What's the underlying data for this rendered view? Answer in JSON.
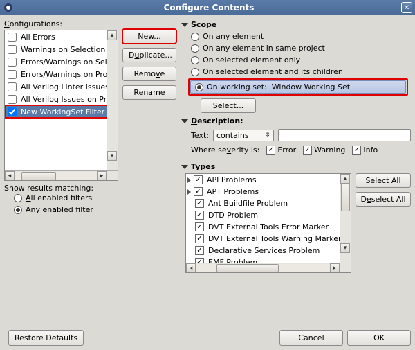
{
  "window": {
    "title": "Configure Contents"
  },
  "left": {
    "header": "Configurations:",
    "items": [
      {
        "label": "All Errors",
        "checked": false,
        "selected": false
      },
      {
        "label": "Warnings on Selection",
        "checked": false,
        "selected": false
      },
      {
        "label": "Errors/Warnings on Select",
        "checked": false,
        "selected": false
      },
      {
        "label": "Errors/Warnings on Projec",
        "checked": false,
        "selected": false
      },
      {
        "label": "All Verilog Linter Issues or",
        "checked": false,
        "selected": false
      },
      {
        "label": "All Verilog Issues on Proje",
        "checked": false,
        "selected": false
      },
      {
        "label": "New WorkingSet Filter",
        "checked": true,
        "selected": true
      }
    ],
    "show_results_label": "Show results matching:",
    "show_results": {
      "all_label": "All enabled filters",
      "any_label": "Any enabled filter",
      "selected": "any"
    }
  },
  "mid": {
    "new": "New...",
    "duplicate": "Duplicate...",
    "remove": "Remove",
    "rename": "Rename"
  },
  "scope": {
    "header": "Scope",
    "opts": {
      "any": "On any element",
      "same_project": "On any element in same project",
      "selected_only": "On selected element only",
      "selected_children": "On selected element and its children",
      "working_set": "On working set:",
      "ws_name": "Window Working Set"
    },
    "selected": "working_set",
    "select_btn": "Select..."
  },
  "description": {
    "header": "Description",
    "text_label": "Text:",
    "combo_value": "contains",
    "text_value": "",
    "sev_label": "Where severity is:",
    "sev": {
      "error_label": "Error",
      "error": true,
      "warning_label": "Warning",
      "warning": true,
      "info_label": "Info",
      "info": true
    }
  },
  "types": {
    "header": "Types",
    "items": [
      {
        "label": "API Problems",
        "checked": true,
        "expandable": true
      },
      {
        "label": "APT Problems",
        "checked": true,
        "expandable": true
      },
      {
        "label": "Ant Buildfile Problem",
        "checked": true,
        "expandable": false
      },
      {
        "label": "DTD Problem",
        "checked": true,
        "expandable": false
      },
      {
        "label": "DVT External Tools Error Marker",
        "checked": true,
        "expandable": false
      },
      {
        "label": "DVT External Tools Warning Marker",
        "checked": true,
        "expandable": false
      },
      {
        "label": "Declarative Services Problem",
        "checked": true,
        "expandable": false
      },
      {
        "label": "EMF Problem",
        "checked": true,
        "expandable": false
      }
    ],
    "select_all": "Select All",
    "deselect_all": "Deselect All"
  },
  "footer": {
    "restore": "Restore Defaults",
    "cancel": "Cancel",
    "ok": "OK"
  }
}
